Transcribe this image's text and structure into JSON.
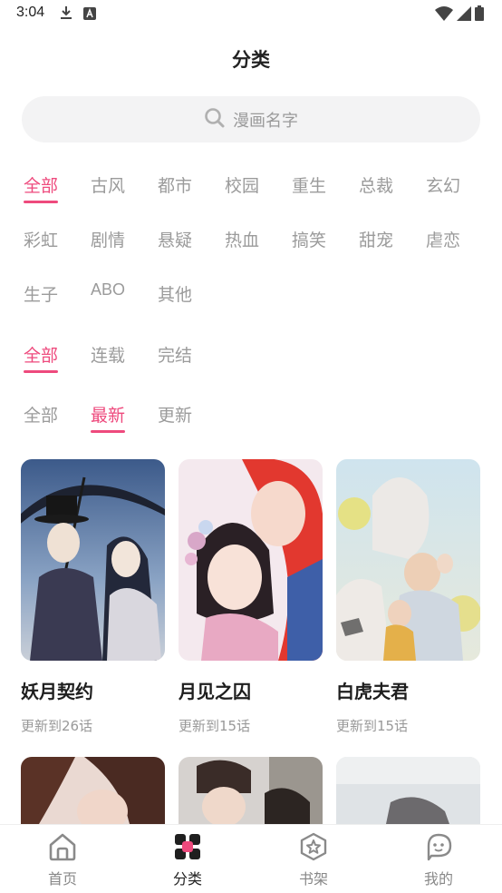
{
  "status_bar": {
    "time": "3:04"
  },
  "header": {
    "title": "分类"
  },
  "search": {
    "placeholder": "漫画名字"
  },
  "genres": {
    "row1": [
      "全部",
      "古风",
      "都市",
      "校园",
      "重生",
      "总裁",
      "玄幻"
    ],
    "row2": [
      "彩虹",
      "剧情",
      "悬疑",
      "热血",
      "搞笑",
      "甜宠",
      "虐恋"
    ],
    "row3": [
      "生子",
      "ABO",
      "其他"
    ],
    "selected": "全部"
  },
  "status_filter": {
    "options": [
      "全部",
      "连载",
      "完结"
    ],
    "selected": "全部"
  },
  "sort_filter": {
    "options": [
      "全部",
      "最新",
      "更新"
    ],
    "selected": "最新"
  },
  "comics": [
    {
      "title": "妖月契约",
      "update": "更新到26话"
    },
    {
      "title": "月见之囚",
      "update": "更新到15话"
    },
    {
      "title": "白虎夫君",
      "update": "更新到15话"
    }
  ],
  "bottom_nav": {
    "items": [
      {
        "label": "首页",
        "icon": "home-icon"
      },
      {
        "label": "分类",
        "icon": "category-grid-icon"
      },
      {
        "label": "书架",
        "icon": "bookshelf-star-icon"
      },
      {
        "label": "我的",
        "icon": "profile-face-icon"
      }
    ],
    "active": "分类"
  },
  "colors": {
    "accent": "#ee4a7d",
    "inactive_text": "#9b9b9b",
    "search_bg": "#f3f3f4"
  }
}
